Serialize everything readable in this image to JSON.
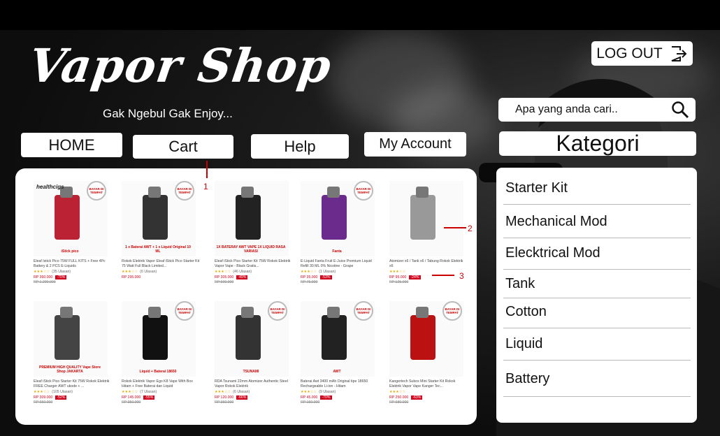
{
  "header": {
    "logo_title": "Vapor Shop",
    "logo_tagline": "Gak Ngebul Gak Enjoy...",
    "logout_label": "LOG OUT",
    "logout_icon": "logout-icon",
    "search_placeholder": "Apa yang anda cari..",
    "search_icon": "search-icon"
  },
  "nav": {
    "home": "HOME",
    "cart": "Cart",
    "help": "Help",
    "my_account": "My Account"
  },
  "categories": {
    "title": "Kategori",
    "items": [
      "Starter Kit",
      "Mechanical Mod",
      "Elecktrical Mod",
      "Tank",
      "Cotton",
      "Liquid",
      "Battery"
    ]
  },
  "products": [
    {
      "name": "Eleaf Istick Pico 75W FULL KITS + Free 4Pc Battery & 2 PCS E-Liquids",
      "rating_count": "(35 Ulasan)",
      "price": "RP 360.000",
      "discount": "-70%",
      "old_price": "RP 1.200.000",
      "img_text": "iStick pico",
      "brand": "healthcigs",
      "badge": true
    },
    {
      "name": "Rokok Elektrik Vapor Eleaf iStick Pico Starter Kit 75 Watt Full Black Limited...",
      "rating_count": "(6 Ulasan)",
      "price": "RP 295.000",
      "discount": "",
      "old_price": "",
      "img_text": "1 x Baterai AWT + 1 x Liquid Original 10 ML",
      "brand": "",
      "badge": true
    },
    {
      "name": "Eleaf iStick Pico Starter Kit 75W Rokok Elektrik Vapor Vape - Black Gratis...",
      "rating_count": "(46 Ulasan)",
      "price": "RP 305.000",
      "discount": "-49%",
      "old_price": "RP 600.000",
      "img_text": "1X BATERAY AWT VAPE 1X LIQUID RASA VARIASI",
      "brand": "",
      "badge": false
    },
    {
      "name": "E-Liquid Fanta Fruit E-Juice Premium Liquid Refill 30 ML 0% Nicotine - Grape",
      "rating_count": "(1 Ulasan)",
      "price": "RP 35.000",
      "discount": "-53%",
      "old_price": "RP 75.000",
      "img_text": "Fanta",
      "brand": "",
      "badge": true
    },
    {
      "name": "Atomizer x6 / Tank x6 / Tabung Rokok Elektrik x6",
      "rating_count": "",
      "price": "RP 95.000",
      "discount": "-24%",
      "old_price": "RP 125.000",
      "img_text": "",
      "brand": "",
      "badge": false
    },
    {
      "name": "Eleaf iStick Pico Starter Kit 75W Rokok Elektrik FREE Charger AWT ukode + ...",
      "rating_count": "(105 Ulasan)",
      "price": "RP 309.000",
      "discount": "-52%",
      "old_price": "RP 650.000",
      "img_text": "PREMIUM HIGH QUALITY Vape Store Shop JAKARTA",
      "brand": "",
      "badge": false
    },
    {
      "name": "Rokok Elektrik Vapor Ego K8 Vape With Box Hitam + Free Baterai dan Liquid",
      "rating_count": "(7 Ulasan)",
      "price": "RP 145.000",
      "discount": "-55%",
      "old_price": "RP 350.000",
      "img_text": "Liquid + Baterai 18650",
      "brand": "",
      "badge": true
    },
    {
      "name": "RDA Tsunami 22mm Atomizer Authentic Steel Vapor Rokok Elektrik",
      "rating_count": "(6 Ulasan)",
      "price": "RP 120.000",
      "discount": "-66%",
      "old_price": "RP 350.000",
      "img_text": "TSUNAMI",
      "brand": "",
      "badge": true
    },
    {
      "name": "Baterai Awt 3400 mAh Original tipe 18650 Rechargeable Li-ion - Hitam",
      "rating_count": "(9 Ulasan)",
      "price": "RP 45.000",
      "discount": "-70%",
      "old_price": "RP 150.000",
      "img_text": "AWT",
      "brand": "",
      "badge": true
    },
    {
      "name": "Kangertech Subox Mini Starter Kit Rokok Elektrik Vapor Vape Kanger Tec...",
      "rating_count": "",
      "price": "RP 250.000",
      "discount": "-63%",
      "old_price": "RP 680.000",
      "img_text": "",
      "brand": "",
      "badge": true
    }
  ],
  "badge_text": "BAYAR DI TEMPAT",
  "annotations": [
    "1",
    "2",
    "3"
  ],
  "colors": {
    "accent_red": "#d0021b",
    "background": "#000000",
    "panel": "#ffffff"
  }
}
